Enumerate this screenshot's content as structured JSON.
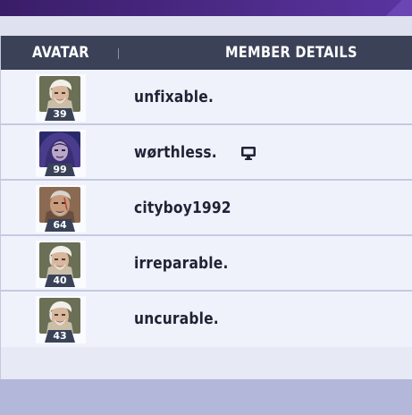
{
  "table": {
    "headers": {
      "avatar": "AVATAR",
      "details": "MEMBER DETAILS"
    },
    "members": [
      {
        "name": "unfixable.",
        "level": "39",
        "avatar": "white-haired-hero-avatar",
        "platform_icon": ""
      },
      {
        "name": "wørthless.",
        "level": "99",
        "avatar": "hooded-purple-hero-avatar",
        "platform_icon": "computer-monitor-icon"
      },
      {
        "name": "cityboy1992",
        "level": "64",
        "avatar": "scarred-hero-avatar",
        "platform_icon": ""
      },
      {
        "name": "irreparable.",
        "level": "40",
        "avatar": "white-haired-hero-avatar",
        "platform_icon": ""
      },
      {
        "name": "uncurable.",
        "level": "43",
        "avatar": "white-haired-hero-avatar",
        "platform_icon": ""
      }
    ]
  }
}
